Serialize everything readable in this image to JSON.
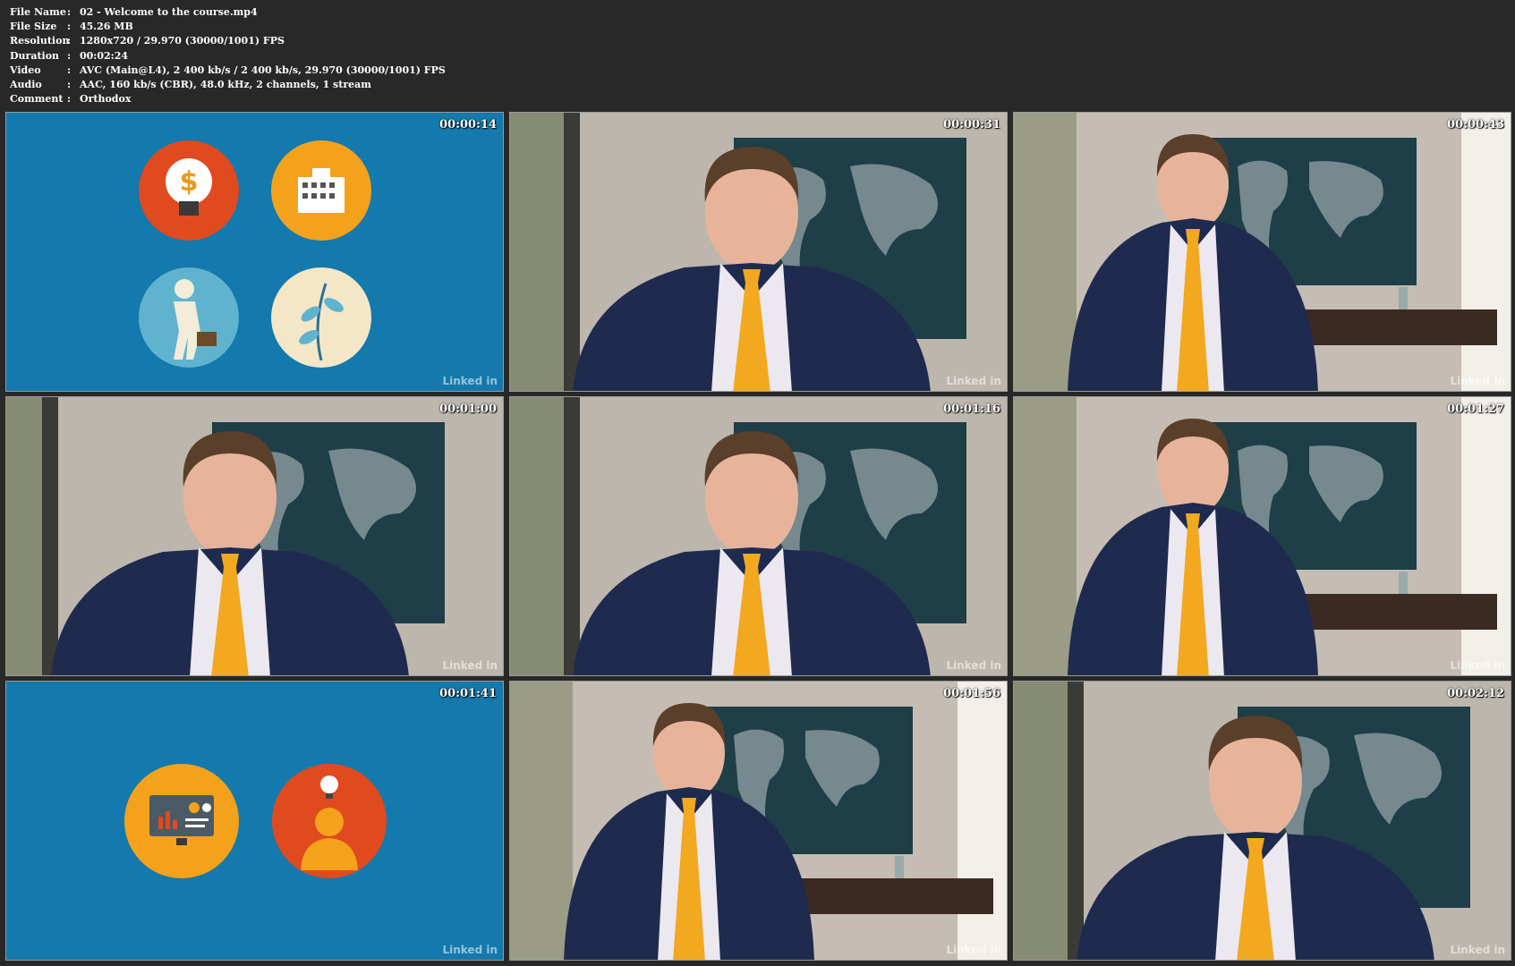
{
  "info": {
    "rows": [
      {
        "label": "File Name",
        "value": "02 - Welcome to the course.mp4"
      },
      {
        "label": "File Size",
        "value": "45.26 MB"
      },
      {
        "label": "Resolution",
        "value": "1280x720 / 29.970 (30000/1001) FPS"
      },
      {
        "label": "Duration",
        "value": "00:02:24"
      },
      {
        "label": "Video",
        "value": "AVC (Main@L4), 2 400 kb/s / 2 400 kb/s, 29.970 (30000/1001) FPS"
      },
      {
        "label": "Audio",
        "value": "AAC, 160 kb/s (CBR), 48.0 kHz, 2 channels, 1 stream"
      },
      {
        "label": "Comment",
        "value": "Orthodox"
      }
    ]
  },
  "separator": ":",
  "brand": "Linked in",
  "thumbnails": [
    {
      "time": "00:00:14",
      "kind": "slide-four-icons",
      "icons": [
        "money-lightbulb-icon",
        "office-building-icon",
        "businessperson-walking-icon",
        "plant-sprout-icon"
      ]
    },
    {
      "time": "00:00:31",
      "kind": "presenter-closeup"
    },
    {
      "time": "00:00:43",
      "kind": "presenter-wide"
    },
    {
      "time": "00:01:00",
      "kind": "presenter-closeup"
    },
    {
      "time": "00:01:16",
      "kind": "presenter-closeup"
    },
    {
      "time": "00:01:27",
      "kind": "presenter-wide"
    },
    {
      "time": "00:01:41",
      "kind": "slide-two-icons",
      "icons": [
        "analytics-monitor-icon",
        "person-idea-icon"
      ]
    },
    {
      "time": "00:01:56",
      "kind": "presenter-wide"
    },
    {
      "time": "00:02:12",
      "kind": "presenter-closeup"
    }
  ],
  "colors": {
    "background": "#282828",
    "slide_blue": "#1479ac",
    "icon_red": "#e04a1f",
    "icon_orange": "#f4a21b",
    "icon_teal": "#5fb3cf",
    "icon_cream": "#f3e7c7",
    "suit_navy": "#1f2a4f",
    "tie_gold": "#f2a81f"
  }
}
